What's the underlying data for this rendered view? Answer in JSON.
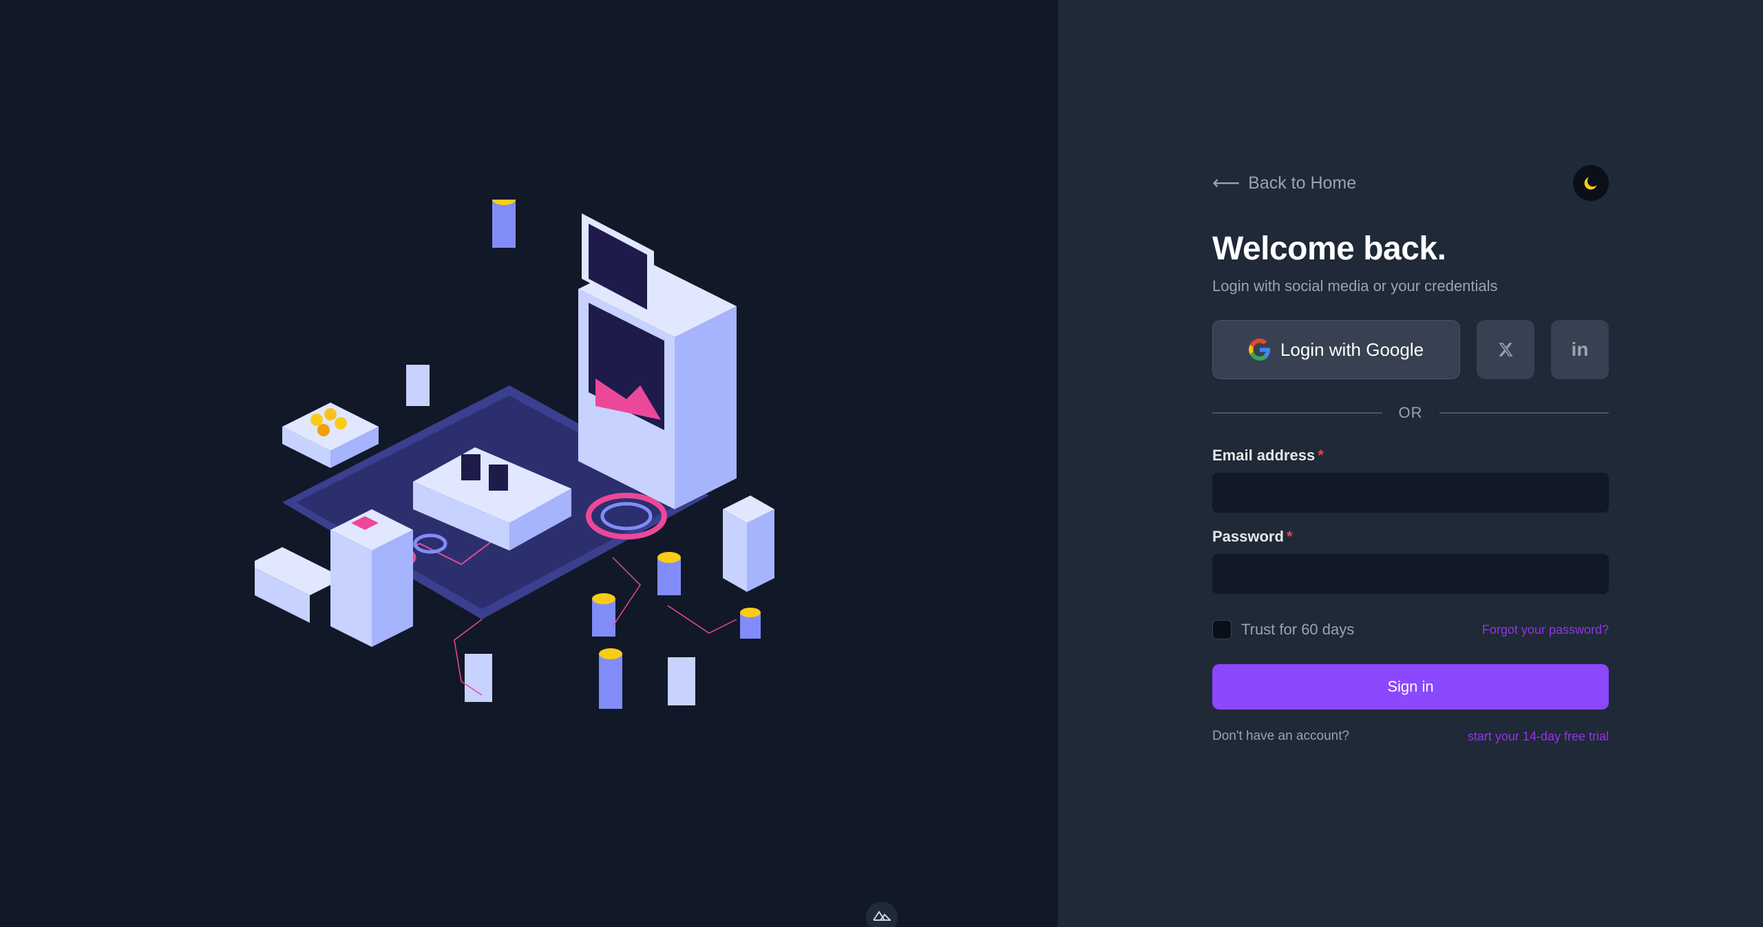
{
  "back_link": {
    "label": "Back to Home",
    "icon": "arrow-left-icon"
  },
  "theme_toggle": {
    "icon": "moon-icon",
    "color": "#facc15"
  },
  "header": {
    "title": "Welcome back.",
    "subtitle": "Login with social media or your credentials"
  },
  "social": {
    "google_label": "Login with Google",
    "twitter_icon": "x-icon",
    "linkedin_icon": "linkedin-icon",
    "linkedin_text": "in"
  },
  "divider": {
    "label": "OR"
  },
  "form": {
    "email_label": "Email address",
    "email_value": "",
    "password_label": "Password",
    "password_value": "",
    "required_mark": "*",
    "trust_label": "Trust for 60 days",
    "forgot_label": "Forgot your password?",
    "submit_label": "Sign in"
  },
  "footer": {
    "no_account": "Don't have an account?",
    "trial_link": "start your 14-day free trial"
  },
  "colors": {
    "accent": "#8b48fc",
    "link": "#9333ea",
    "left_bg": "#111827",
    "right_bg": "#1f2937"
  }
}
